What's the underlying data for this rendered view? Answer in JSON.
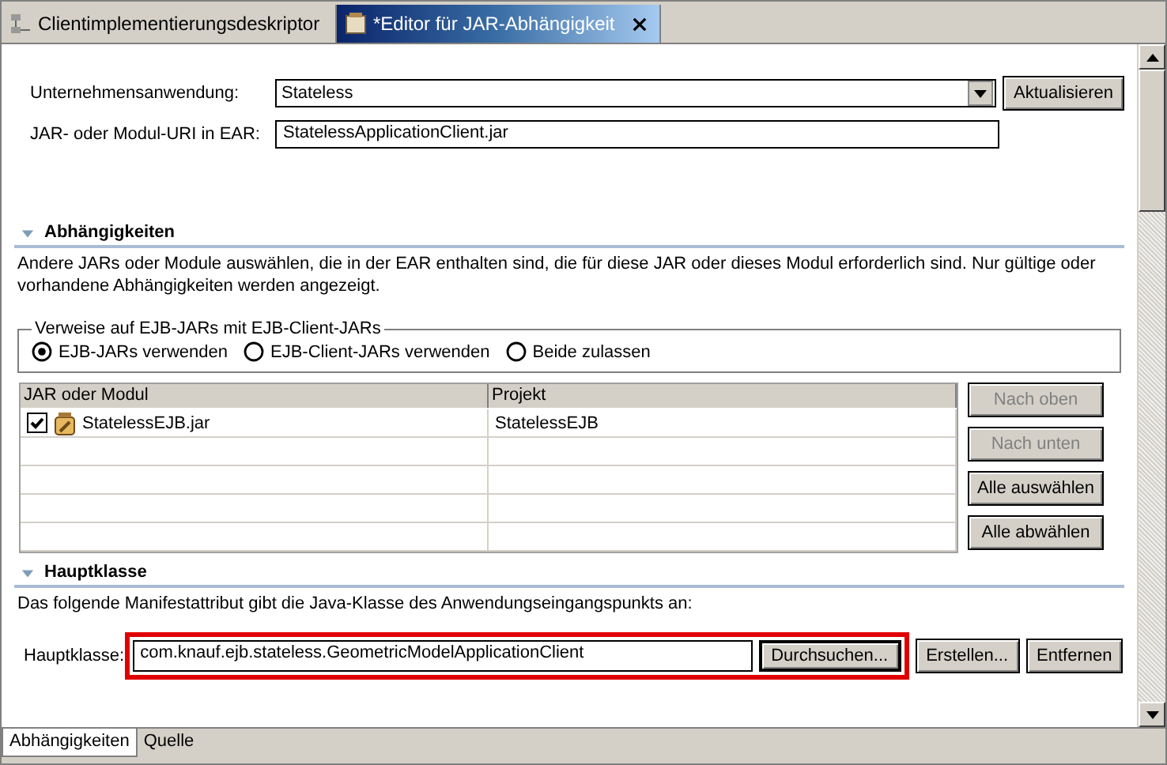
{
  "editor_tabs": [
    {
      "label": "Clientimplementierungsdeskriptor",
      "selected": false
    },
    {
      "label": "*Editor für JAR-Abhängigkeit",
      "selected": true
    }
  ],
  "enterprise_application": {
    "label": "Unternehmensanwendung:",
    "value": "Stateless",
    "button": "Aktualisieren"
  },
  "module_uri": {
    "label": "JAR- oder Modul-URI in EAR:",
    "value": "StatelessApplicationClient.jar"
  },
  "dependencies": {
    "title": "Abhängigkeiten",
    "expanded": true,
    "description": "Andere JARs oder Module auswählen, die in der EAR enthalten sind, die für diese JAR oder dieses Modul erforderlich sind.  Nur gültige oder vorhandene Abhängigkeiten werden angezeigt.",
    "group": {
      "title": "Verweise auf EJB-JARs mit EJB-Client-JARs",
      "options": [
        {
          "label": "EJB-JARs verwenden",
          "selected": true
        },
        {
          "label": "EJB-Client-JARs verwenden",
          "selected": false
        },
        {
          "label": "Beide zulassen",
          "selected": false
        }
      ]
    },
    "table": {
      "columns": [
        "JAR oder Modul",
        "Projekt"
      ],
      "rows": [
        {
          "checked": true,
          "cells": [
            "StatelessEJB.jar",
            "StatelessEJB"
          ]
        }
      ]
    },
    "buttons": [
      {
        "label": "Nach oben",
        "disabled": true
      },
      {
        "label": "Nach unten",
        "disabled": true
      },
      {
        "label": "Alle auswählen",
        "disabled": false
      },
      {
        "label": "Alle abwählen",
        "disabled": false
      }
    ]
  },
  "main_class": {
    "title": "Hauptklasse",
    "expanded": true,
    "description": "Das folgende Manifestattribut gibt die Java-Klasse des Anwendungseingangspunkts an:",
    "field": {
      "label": "Hauptklasse:",
      "value": "com.knauf.ejb.stateless.GeometricModelApplicationClient"
    },
    "buttons": [
      {
        "label": "Durchsuchen...",
        "focused": true
      },
      {
        "label": "Erstellen...",
        "focused": false
      },
      {
        "label": "Entfernen",
        "focused": false
      }
    ]
  },
  "bottom_tabs": [
    {
      "label": "Abhängigkeiten",
      "selected": true
    },
    {
      "label": "Quelle",
      "selected": false
    }
  ]
}
